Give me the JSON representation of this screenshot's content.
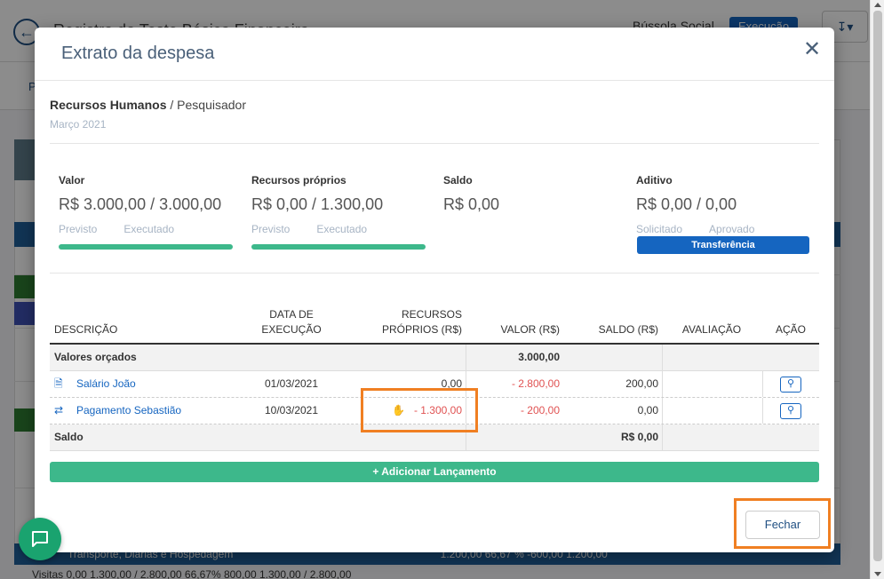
{
  "background": {
    "title": "Registro do Teste Básico Financeiro",
    "bussola": "Bússola Social",
    "status_badge": "Execução",
    "tab_initial": "P",
    "footer_row": "Transporte, Diárias e Hospedagem",
    "footer_values": "1.200,00     66,67 %     -600,00     1.200,00",
    "footer_row2": "Visitas   0,00   1.300,00 / 2.800,00   66,67%   800,00   1.300,00 / 2.800,00"
  },
  "modal": {
    "title": "Extrato da despesa",
    "category": "Recursos Humanos",
    "separator": " / ",
    "subcategory": "Pesquisador",
    "period": "Março 2021"
  },
  "summary": {
    "valor": {
      "label": "Valor",
      "value": "R$ 3.000,00 / 3.000,00",
      "sub1": "Previsto",
      "sub2": "Executado",
      "progress": 1.0
    },
    "recursos": {
      "label": "Recursos próprios",
      "value": "R$ 0,00 / 1.300,00",
      "sub1": "Previsto",
      "sub2": "Executado",
      "progress": 1.0
    },
    "saldo": {
      "label": "Saldo",
      "value": "R$ 0,00"
    },
    "aditivo": {
      "label": "Aditivo",
      "value": "R$ 0,00 / 0,00",
      "sub1": "Solicitado",
      "sub2": "Aprovado",
      "button": "Transferência"
    }
  },
  "table": {
    "headers": {
      "descricao": "Descrição",
      "data_l1": "Data de",
      "data_l2": "execução",
      "recursos_l1": "Recursos",
      "recursos_l2": "próprios (R$)",
      "valor": "Valor (R$)",
      "saldo": "Saldo (R$)",
      "avaliacao": "Avaliação",
      "acao": "Ação"
    },
    "orcados": {
      "label": "Valores orçados",
      "valor": "3.000,00"
    },
    "rows": [
      {
        "descricao": "Salário João",
        "data": "01/03/2021",
        "recursos": "0,00",
        "valor": "- 2.800,00",
        "saldo": "200,00"
      },
      {
        "descricao": "Pagamento Sebastião",
        "data": "10/03/2021",
        "recursos": "- 1.300,00",
        "valor": "- 200,00",
        "saldo": "0,00"
      }
    ],
    "saldo_row": {
      "label": "Saldo",
      "value": "R$ 0,00"
    }
  },
  "actions": {
    "add": "Adicionar Lançamento",
    "close": "Fechar"
  },
  "colors": {
    "accent": "#1565c0",
    "progress": "#3db88b",
    "negative": "#e05252",
    "highlight": "#f07f22"
  }
}
